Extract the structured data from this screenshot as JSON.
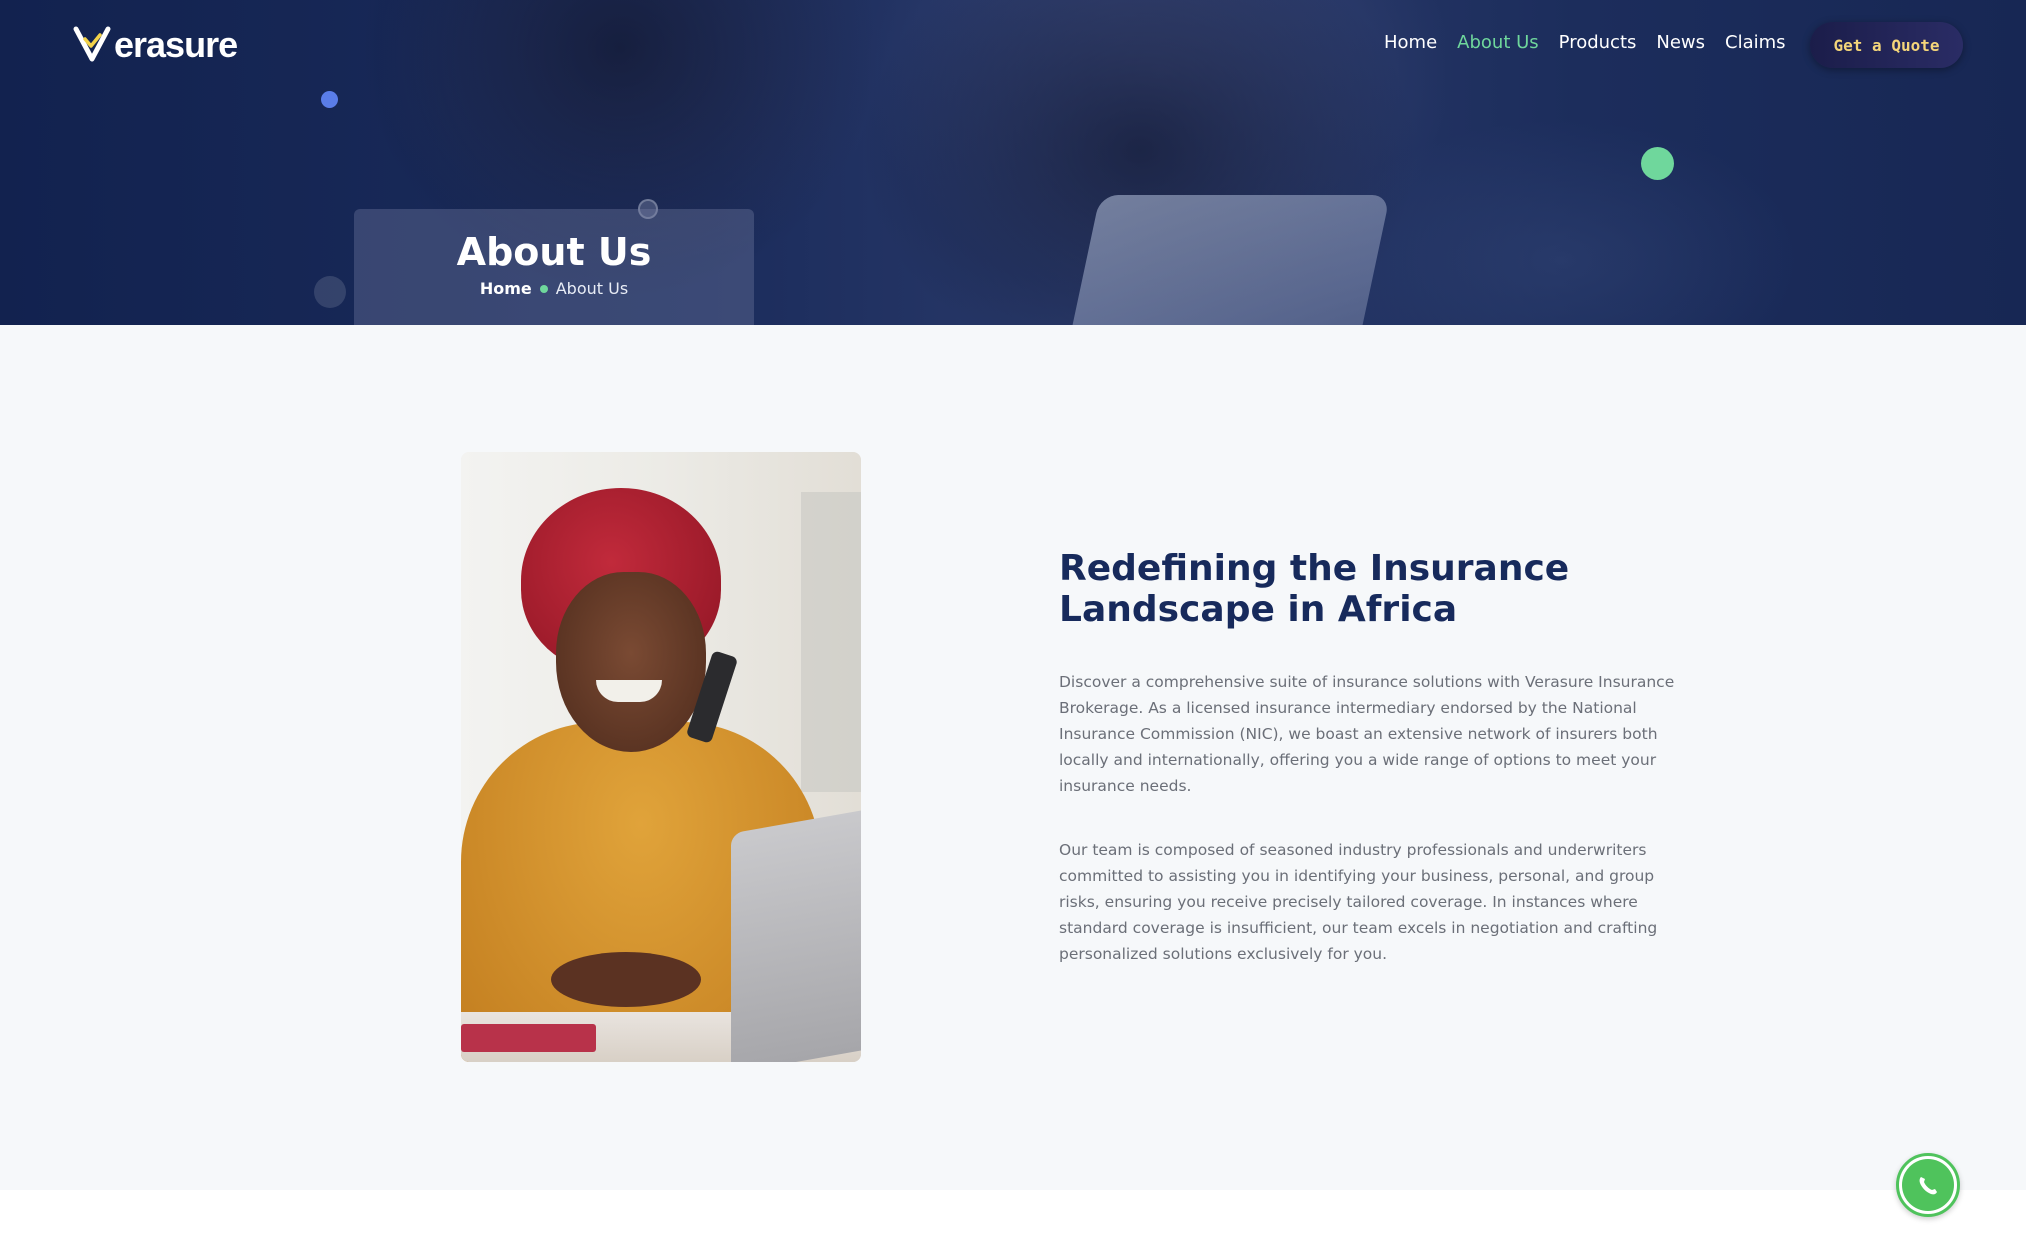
{
  "brand": {
    "name": "erasure",
    "accent": "#6fd79c",
    "navy": "#172a5c"
  },
  "nav": {
    "items": [
      {
        "label": "Home"
      },
      {
        "label": "About Us"
      },
      {
        "label": "Products"
      },
      {
        "label": "News"
      },
      {
        "label": "Claims"
      }
    ],
    "active": "About Us",
    "quote_label": "Get a Quote"
  },
  "hero": {
    "title": "About Us",
    "breadcrumb": {
      "home": "Home",
      "current": "About Us"
    }
  },
  "about": {
    "heading_line1": "Redefining the Insurance",
    "heading_line2": "Landscape in Africa",
    "paragraph1": "Discover a comprehensive suite of insurance solutions with Verasure Insurance Brokerage. As a licensed insurance intermediary endorsed by the National Insurance Commission (NIC), we boast an extensive network of insurers both locally and internationally, offering you a wide range of options to meet your insurance needs.",
    "paragraph2": "Our team is composed of seasoned industry professionals and underwriters committed to assisting you in identifying your business, personal, and group risks, ensuring you receive precisely tailored coverage. In instances where standard coverage is insufficient, our team excels in negotiation and crafting personalized solutions exclusively for you."
  },
  "icons": {
    "logo": "shield-check-icon",
    "chat": "whatsapp-icon"
  }
}
